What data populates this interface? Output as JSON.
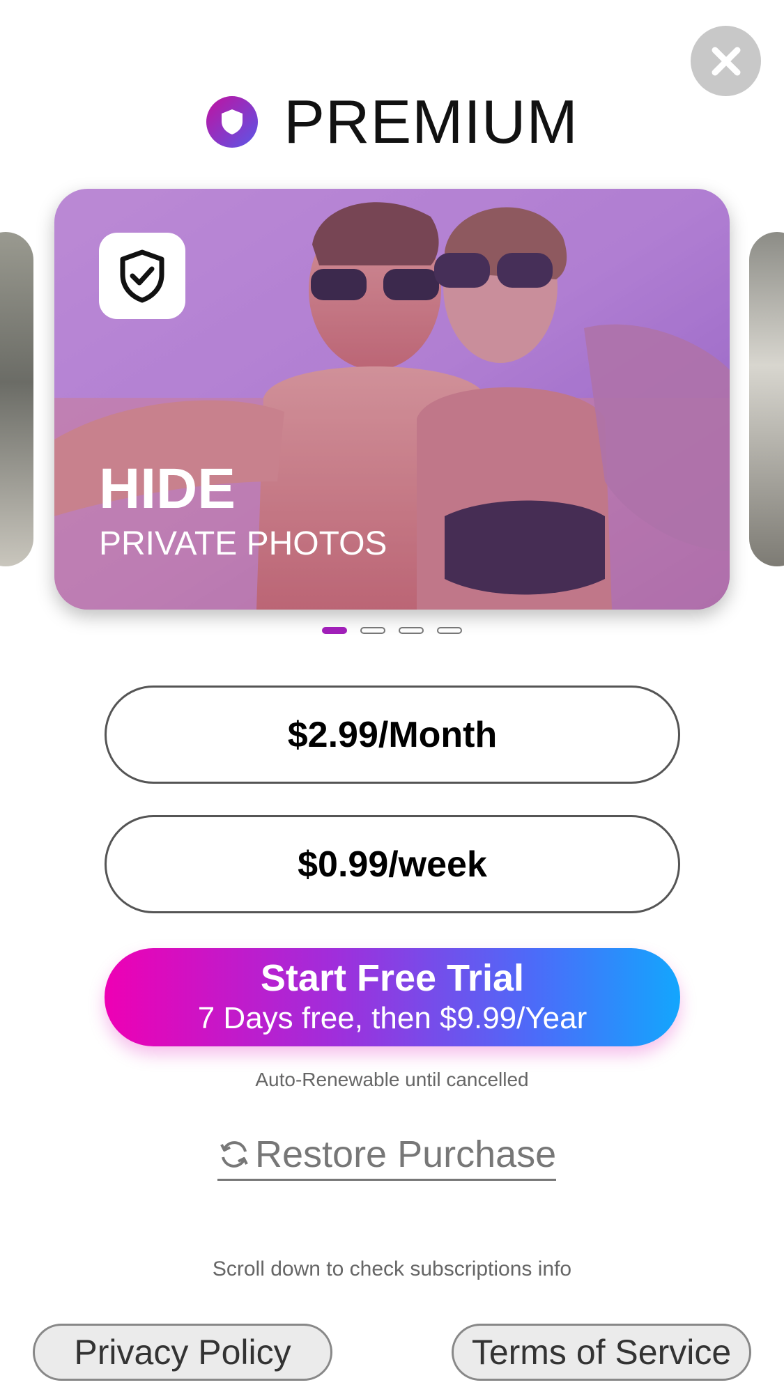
{
  "header": {
    "title": "PREMIUM",
    "icon": "shield-logo-icon"
  },
  "close": {
    "icon": "close-icon"
  },
  "hero": {
    "title": "HIDE",
    "subtitle": "PRIVATE PHOTOS",
    "icon": "shield-check-icon",
    "carousel_active_index": 0,
    "carousel_count": 4
  },
  "plans": [
    {
      "label": "$2.99/Month"
    },
    {
      "label": "$0.99/week"
    }
  ],
  "cta": {
    "title": "Start Free Trial",
    "subtitle": "7 Days free, then $9.99/Year"
  },
  "auto_renew_text": "Auto-Renewable until cancelled",
  "restore": {
    "label": "Restore Purchase",
    "icon": "refresh-icon"
  },
  "scroll_info": "Scroll down to check subscriptions info",
  "links": {
    "privacy": "Privacy Policy",
    "terms": "Terms of Service"
  },
  "colors": {
    "accent": "#a01fb8",
    "cta_gradient_start": "#ee00b4",
    "cta_gradient_end": "#13a6fd"
  }
}
